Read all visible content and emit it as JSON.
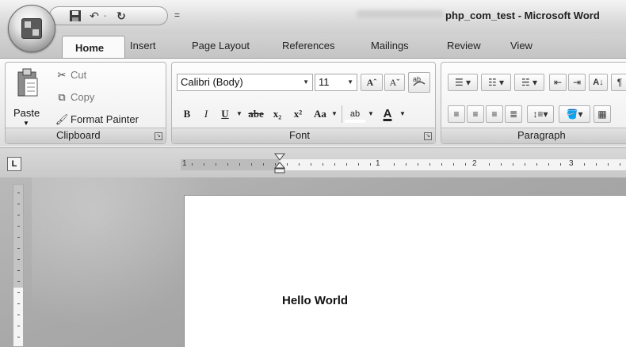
{
  "window": {
    "title": "php_com_test - Microsoft Word",
    "customize_glyph": "="
  },
  "quick_access": {
    "save_icon": "save-icon",
    "undo_icon": "undo-icon",
    "undo_glyph": "↶",
    "redo_icon": "redo-icon",
    "redo_glyph": "↻",
    "dropdown_glyph": "-"
  },
  "tabs": [
    {
      "label": "Home"
    },
    {
      "label": "Insert"
    },
    {
      "label": "Page Layout"
    },
    {
      "label": "References"
    },
    {
      "label": "Mailings"
    },
    {
      "label": "Review"
    },
    {
      "label": "View"
    }
  ],
  "clipboard": {
    "paste_label": "Paste",
    "cut_label": "Cut",
    "copy_label": "Copy",
    "format_painter_label": "Format Painter",
    "group_label": "Clipboard"
  },
  "font": {
    "font_name": "Calibri (Body)",
    "font_size": "11",
    "grow_label": "Aˆ",
    "shrink_label": "Aˇ",
    "bold_label": "B",
    "italic_label": "I",
    "underline_label": "U",
    "strike_label": "abe",
    "subscript_label": "x₂",
    "superscript_label": "x²",
    "case_label": "Aa",
    "highlight_label": "ab",
    "color_label": "A",
    "group_label": "Font"
  },
  "paragraph": {
    "group_label": "Paragraph"
  },
  "ruler": {
    "tab_selector": "L",
    "numbers": [
      "1",
      "1",
      "2",
      "3"
    ]
  },
  "document": {
    "text": "Hello World"
  }
}
